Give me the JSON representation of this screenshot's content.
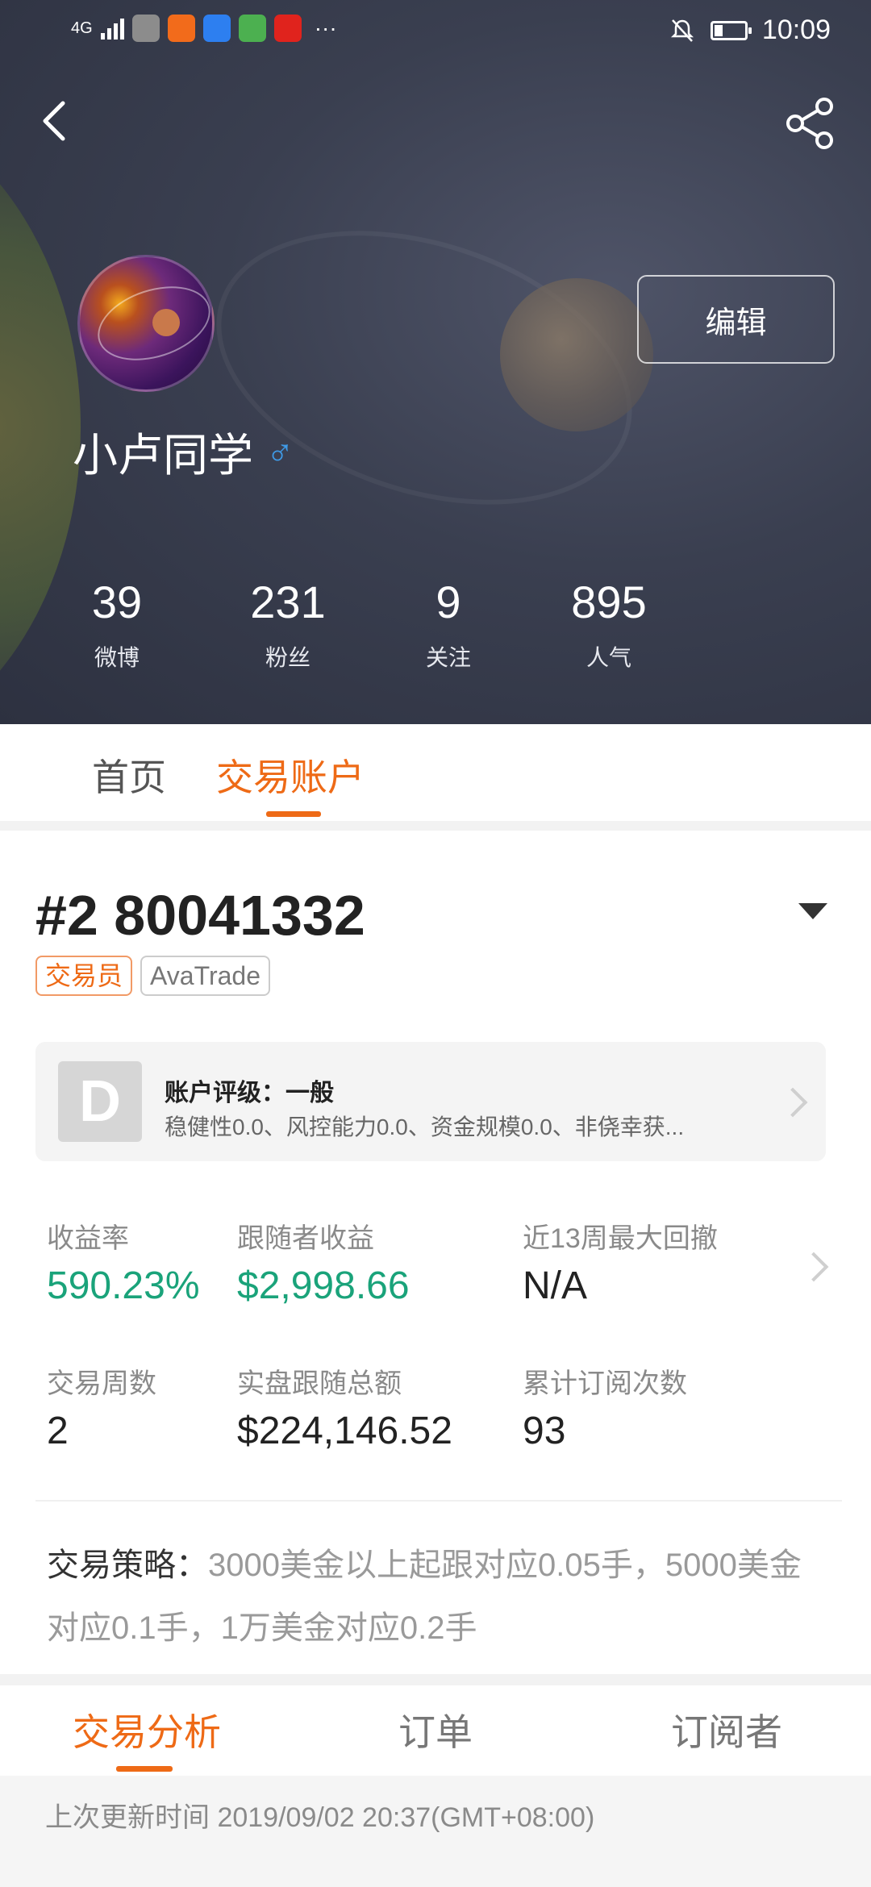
{
  "status_bar": {
    "network": "4G",
    "time": "10:09",
    "more": "···"
  },
  "profile": {
    "username": "小卢同学",
    "gender_symbol": "♂",
    "edit_label": "编辑"
  },
  "stats": [
    {
      "value": "39",
      "label": "微博"
    },
    {
      "value": "231",
      "label": "粉丝"
    },
    {
      "value": "9",
      "label": "关注"
    },
    {
      "value": "895",
      "label": "人气"
    }
  ],
  "top_tabs": [
    {
      "label": "首页",
      "active": false
    },
    {
      "label": "交易账户",
      "active": true
    }
  ],
  "account": {
    "title": "#2 80041332",
    "badges": [
      "交易员",
      "AvaTrade"
    ],
    "rating_grade": "D",
    "rating_title": "账户评级：一般",
    "rating_detail": "稳健性0.0、风控能力0.0、资金规模0.0、非侥幸获..."
  },
  "metrics": [
    {
      "label": "收益率",
      "value": "590.23%"
    },
    {
      "label": "跟随者收益",
      "value": "$2,998.66"
    },
    {
      "label": "近13周最大回撤",
      "value": "N/A"
    },
    {
      "label": "交易周数",
      "value": "2"
    },
    {
      "label": "实盘跟随总额",
      "value": "$224,146.52"
    },
    {
      "label": "累计订阅次数",
      "value": "93"
    }
  ],
  "strategy": {
    "label": "交易策略：",
    "text": "3000美金以上起跟对应0.05手，5000美金对应0.1手，1万美金对应0.2手"
  },
  "bottom_tabs": [
    {
      "label": "交易分析",
      "active": true
    },
    {
      "label": "订单",
      "active": false
    },
    {
      "label": "订阅者",
      "active": false
    }
  ],
  "update": {
    "text": "上次更新时间 2019/09/02 20:37(GMT+08:00)"
  },
  "colors": {
    "accent": "#ee6a16",
    "positive": "#1aa37a",
    "hero_bg": "#3a3f50"
  }
}
